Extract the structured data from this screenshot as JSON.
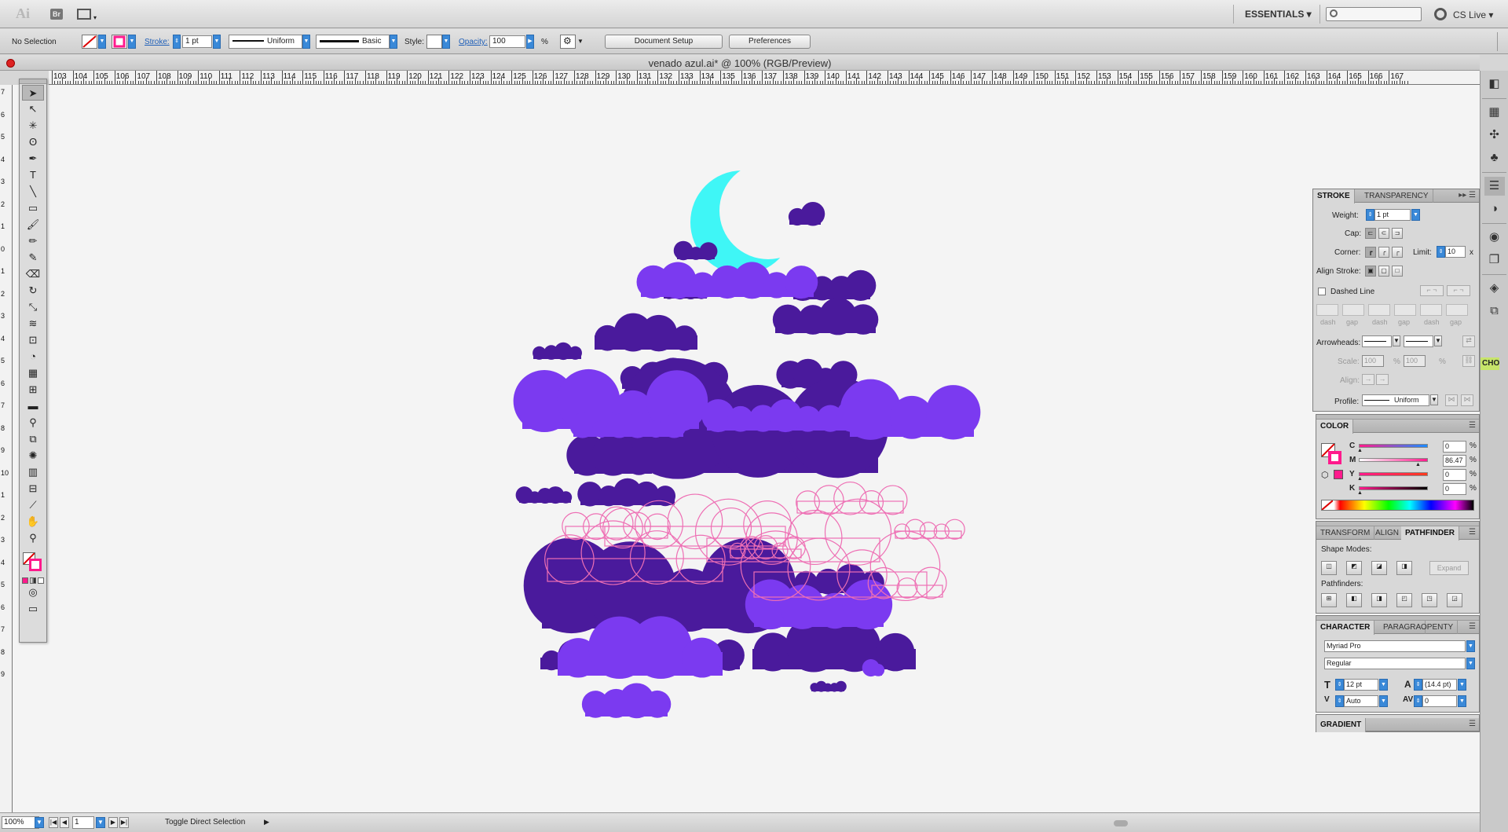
{
  "app": {
    "logo": "Ai",
    "bridge": "Br",
    "workspace": "ESSENTIALS ▾",
    "cs_live": "CS Live ▾"
  },
  "control": {
    "selection": "No Selection",
    "stroke_label": "Stroke:",
    "stroke_weight": "1 pt",
    "profile": "Uniform",
    "brush": "Basic",
    "style_label": "Style:",
    "opacity_label": "Opacity:",
    "opacity_value": "100",
    "opacity_unit": "%",
    "document_setup": "Document Setup",
    "preferences": "Preferences"
  },
  "document": {
    "title": "venado azul.ai* @ 100% (RGB/Preview)"
  },
  "ruler": {
    "top_start": 103,
    "top_end": 167,
    "left_labels": [
      "7",
      "6",
      "5",
      "4",
      "3",
      "2",
      "1",
      "0",
      "1",
      "2",
      "3",
      "4",
      "5",
      "6",
      "7",
      "8",
      "9",
      "10",
      "1",
      "2",
      "3",
      "4",
      "5",
      "6",
      "7",
      "8",
      "9"
    ]
  },
  "tools": [
    {
      "name": "selection-tool",
      "glyph": "➤"
    },
    {
      "name": "direct-selection-tool",
      "glyph": "↖"
    },
    {
      "name": "magic-wand-tool",
      "glyph": "✳"
    },
    {
      "name": "lasso-tool",
      "glyph": "ʘ"
    },
    {
      "name": "pen-tool",
      "glyph": "✒"
    },
    {
      "name": "type-tool",
      "glyph": "T"
    },
    {
      "name": "line-segment-tool",
      "glyph": "╲"
    },
    {
      "name": "rectangle-tool",
      "glyph": "▭"
    },
    {
      "name": "paintbrush-tool",
      "glyph": "🖌"
    },
    {
      "name": "pencil-tool",
      "glyph": "✏"
    },
    {
      "name": "blob-brush-tool",
      "glyph": "✎"
    },
    {
      "name": "eraser-tool",
      "glyph": "⌫"
    },
    {
      "name": "rotate-tool",
      "glyph": "↻"
    },
    {
      "name": "scale-tool",
      "glyph": "⤡"
    },
    {
      "name": "warp-tool",
      "glyph": "≋"
    },
    {
      "name": "free-transform-tool",
      "glyph": "⊡"
    },
    {
      "name": "shape-builder-tool",
      "glyph": "◔"
    },
    {
      "name": "perspective-grid-tool",
      "glyph": "▦"
    },
    {
      "name": "mesh-tool",
      "glyph": "⊞"
    },
    {
      "name": "gradient-tool",
      "glyph": "▬"
    },
    {
      "name": "eyedropper-tool",
      "glyph": "⚲"
    },
    {
      "name": "blend-tool",
      "glyph": "⧉"
    },
    {
      "name": "symbol-sprayer-tool",
      "glyph": "✺"
    },
    {
      "name": "column-graph-tool",
      "glyph": "▥"
    },
    {
      "name": "artboard-tool",
      "glyph": "⊟"
    },
    {
      "name": "slice-tool",
      "glyph": "⟋"
    },
    {
      "name": "hand-tool",
      "glyph": "✋"
    },
    {
      "name": "zoom-tool",
      "glyph": "⚲"
    }
  ],
  "status": {
    "zoom": "100%",
    "page": "1",
    "message": "Toggle Direct Selection"
  },
  "stroke_panel": {
    "tab_stroke": "STROKE",
    "tab_transparency": "TRANSPARENCY",
    "weight_label": "Weight:",
    "weight_value": "1 pt",
    "cap_label": "Cap:",
    "corner_label": "Corner:",
    "limit_label": "Limit:",
    "limit_value": "10",
    "limit_unit": "x",
    "align_label": "Align Stroke:",
    "dashed_label": "Dashed Line",
    "dash_labels": [
      "dash",
      "gap",
      "dash",
      "gap",
      "dash",
      "gap"
    ],
    "arrowheads_label": "Arrowheads:",
    "scale_label": "Scale:",
    "scale_1": "100",
    "scale_2": "100",
    "pct": "%",
    "align_row_label": "Align:",
    "profile_label": "Profile:",
    "profile_value": "Uniform"
  },
  "color_panel": {
    "title": "COLOR",
    "channels": [
      {
        "name": "C",
        "value": "0",
        "pos": 0.0
      },
      {
        "name": "M",
        "value": "86.47",
        "pos": 0.86
      },
      {
        "name": "Y",
        "value": "0",
        "pos": 0.0
      },
      {
        "name": "K",
        "value": "0",
        "pos": 0.0
      }
    ],
    "pct": "%",
    "fill_color": "#ff1a8c"
  },
  "pathfinder_panel": {
    "tab_transform": "TRANSFORM",
    "tab_align": "ALIGN",
    "tab_pathfinder": "PATHFINDER",
    "shape_modes": "Shape Modes:",
    "expand": "Expand",
    "pathfinders": "Pathfinders:"
  },
  "character_panel": {
    "tab_character": "CHARACTER",
    "tab_paragraph": "PARAGRA",
    "tab_opentype": "OPENTY",
    "font": "Myriad Pro",
    "style": "Regular",
    "size": "12 pt",
    "leading": "(14.4 pt)",
    "kerning": "Auto",
    "tracking": "0"
  },
  "gradient_panel": {
    "title": "GRADIENT"
  },
  "dock": {
    "cho_label": "CHO"
  },
  "art_colors": {
    "dark": "#4a1a9c",
    "light": "#7b3af0",
    "moon": "#3ff6f6",
    "outline": "#ee6fb4"
  }
}
